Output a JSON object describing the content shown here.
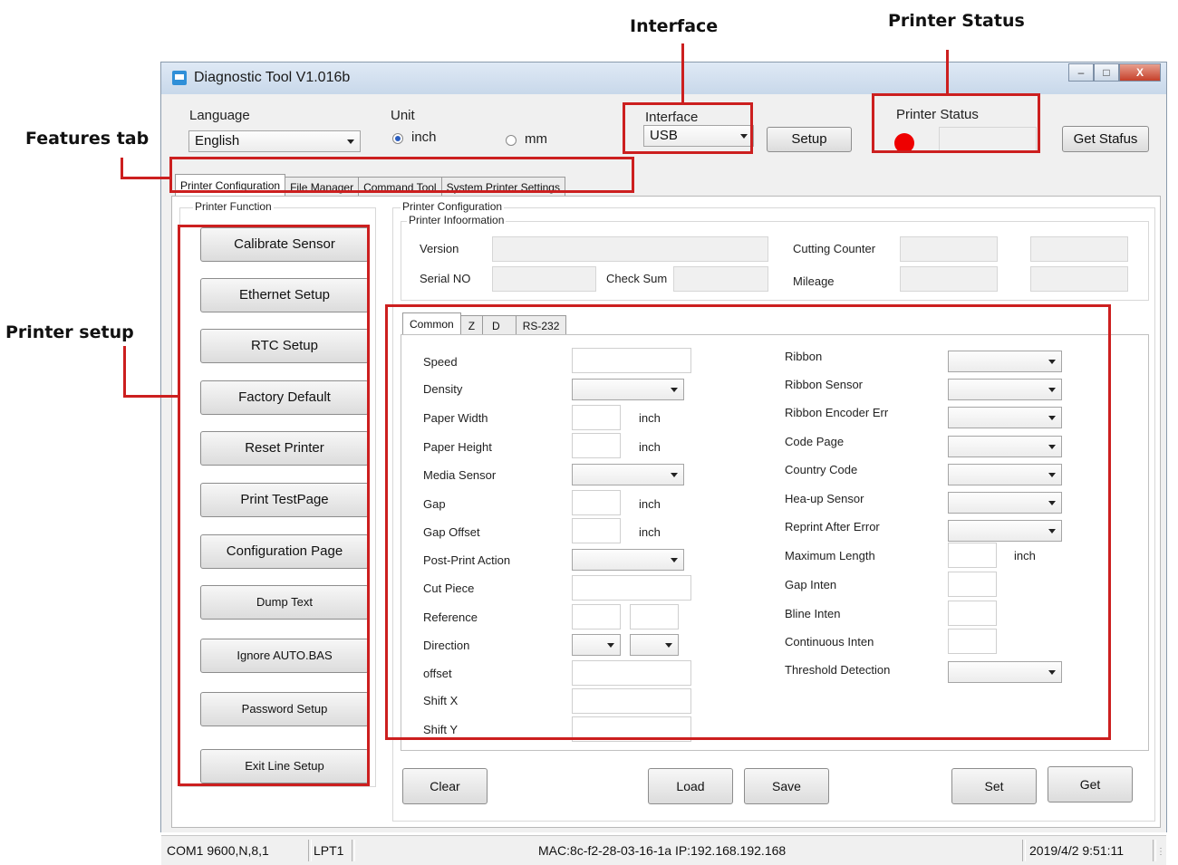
{
  "callouts": {
    "interface": "Interface",
    "printer_status": "Printer Status",
    "features_tab": "Features tab",
    "printer_setup": "Printer setup"
  },
  "window": {
    "title": "Diagnostic Tool V1.016b",
    "icon": "printer-icon"
  },
  "top": {
    "language_label": "Language",
    "language_value": "English",
    "unit_label": "Unit",
    "unit_inch": "inch",
    "unit_mm": "mm",
    "unit_selected": "inch",
    "interface_label": "Interface",
    "interface_value": "USB",
    "setup_button": "Setup",
    "printer_status_label": "Printer  Status",
    "status_color": "#ee0000",
    "get_status_button": "Get Stafus"
  },
  "feature_tabs": [
    "Printer Configuration",
    "File Manager",
    "Command Tool",
    "System Printer Settings"
  ],
  "printer_function": {
    "title": "Printer  Function",
    "buttons": [
      "Calibrate Sensor",
      "Ethernet Setup",
      "RTC Setup",
      "Factory Default",
      "Reset Printer",
      "Print TestPage",
      "Configuration Page",
      "Dump Text",
      "Ignore AUTO.BAS",
      "Password Setup",
      "Exit Line Setup"
    ]
  },
  "config": {
    "title": "Printer Configuration",
    "info_title": "Printer Infoormation",
    "version": "Version",
    "serial_no": "Serial NO",
    "check_sum": "Check Sum",
    "cutting_counter": "Cutting Counter",
    "mileage": "Mileage"
  },
  "sub_tabs": [
    "Common",
    "Z",
    "D",
    "RS-232"
  ],
  "common_left": {
    "speed": "Speed",
    "density": "Density",
    "paper_width": "Paper Width",
    "paper_height": "Paper Height",
    "media_sensor": "Media Sensor",
    "gap": "Gap",
    "gap_offset": "Gap Offset",
    "post_print_action": "Post-Print  Action",
    "cut_piece": "Cut  Piece",
    "reference": "Reference",
    "direction": "Direction",
    "offset": "offset",
    "shift_x": "Shift X",
    "shift_y": "Shift Y",
    "unit": "inch"
  },
  "common_right": {
    "ribbon": "Ribbon",
    "ribbon_sensor": "Ribbon  Sensor",
    "ribbon_encoder_err": "Ribbon Encoder Err",
    "code_page": "Code Page",
    "country_code": "Country Code",
    "head_up_sensor": "Hea-up  Sensor",
    "reprint_after_error": "Reprint After  Error",
    "maximum_length": "Maximum Length",
    "gap_inten": "Gap Inten",
    "bline_inten": "Bline  Inten",
    "continuous_inten": "Continuous  Inten",
    "threshold_detection": "Threshold  Detection",
    "unit": "inch"
  },
  "bottom_buttons": {
    "clear": "Clear",
    "load": "Load",
    "save": "Save",
    "set": "Set",
    "get": "Get"
  },
  "statusbar": {
    "com": "COM1 9600,N,8,1",
    "lpt": "LPT1",
    "net": "MAC:8c-f2-28-03-16-1a   IP:192.168.192.168",
    "datetime": "2019/4/2 9:51:11"
  },
  "accent": "#cc1f1f"
}
